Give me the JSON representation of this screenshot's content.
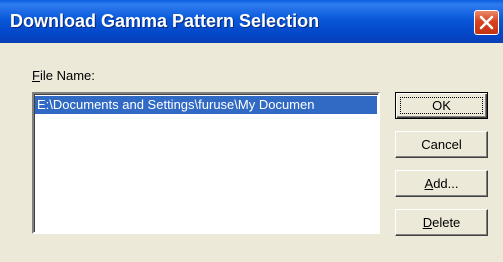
{
  "window": {
    "title": "Download Gamma Pattern Selection"
  },
  "file_list": {
    "label_accel": "F",
    "label_rest": "ile Name:",
    "items": [
      {
        "text": "E:\\Documents and Settings\\furuse\\My Documen"
      }
    ]
  },
  "buttons": {
    "ok": {
      "accel": "",
      "rest": "OK"
    },
    "cancel": {
      "accel": "",
      "rest": "Cancel"
    },
    "add": {
      "accel": "A",
      "rest": "dd..."
    },
    "delete": {
      "accel": "D",
      "rest": "elete"
    }
  },
  "colors": {
    "title_bar": "#0858d8",
    "selection": "#316ac5",
    "dialog_bg": "#ece9d8",
    "close_button": "#d8431f"
  },
  "icons": {
    "close": "close-x-icon"
  }
}
